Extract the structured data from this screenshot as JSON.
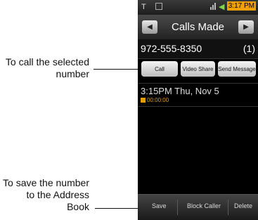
{
  "callouts": {
    "call": "To call the selected number",
    "save": "To save the number to the Address Book"
  },
  "status": {
    "time": "3:17 PM"
  },
  "header": {
    "title": "Calls Made",
    "prev_icon": "◀",
    "next_icon": "▶"
  },
  "contact": {
    "number": "972-555-8350",
    "count": "(1)"
  },
  "actions": {
    "call": "Call",
    "video_share": "Video Share",
    "send_message": "Send Message"
  },
  "log": {
    "datetime": "3:15PM Thu, Nov 5",
    "duration": "00:00:00"
  },
  "bottom": {
    "save": "Save",
    "block": "Block Caller",
    "delete": "Delete"
  },
  "colors": {
    "accent": "#f0a000",
    "background": "#000000"
  }
}
